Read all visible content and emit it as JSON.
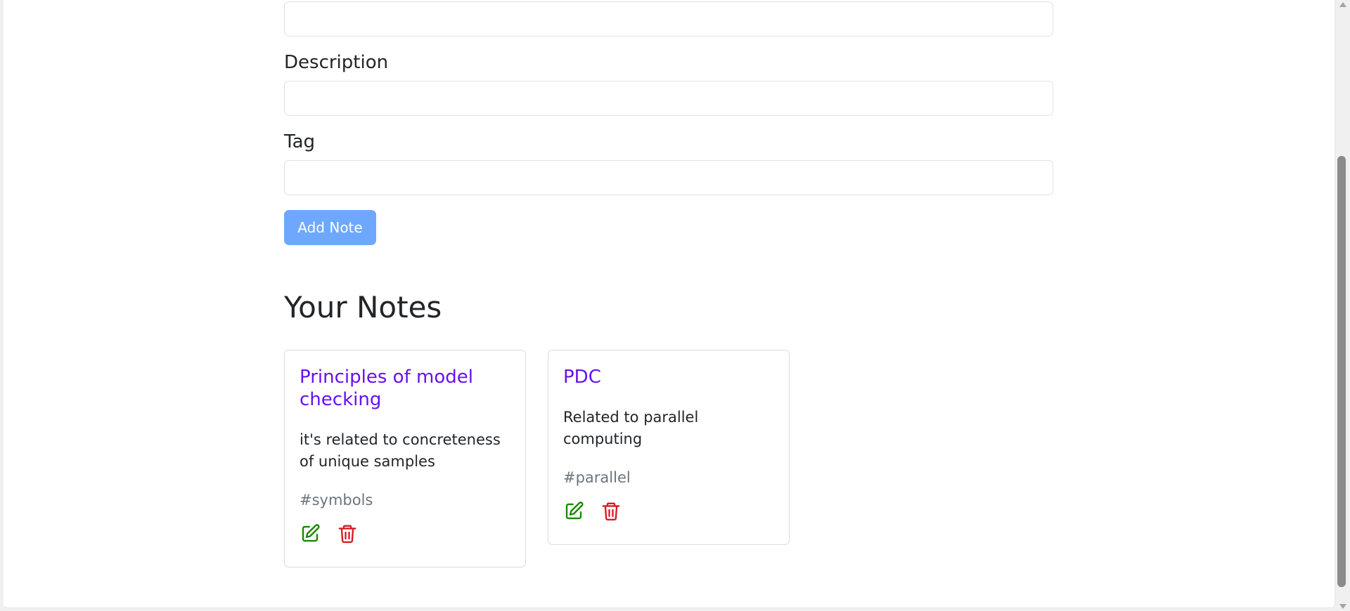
{
  "form": {
    "title_value": "",
    "description_label": "Description",
    "description_value": "",
    "tag_label": "Tag",
    "tag_value": "",
    "add_button_label": "Add Note"
  },
  "notes_section": {
    "heading": "Your Notes",
    "notes": [
      {
        "title": "Principles of model checking",
        "description": "it's related to concreteness of unique samples",
        "tag": "#symbols",
        "edit_icon": "edit-icon",
        "delete_icon": "trash-icon"
      },
      {
        "title": "PDC",
        "description": "Related to parallel computing",
        "tag": "#parallel",
        "edit_icon": "edit-icon",
        "delete_icon": "trash-icon"
      }
    ]
  },
  "colors": {
    "note_title": "#6610f2",
    "add_button": "#6ea8fe",
    "edit_icon": "#198700",
    "delete_icon": "#dc1a26",
    "tag_text": "#6c757d"
  }
}
